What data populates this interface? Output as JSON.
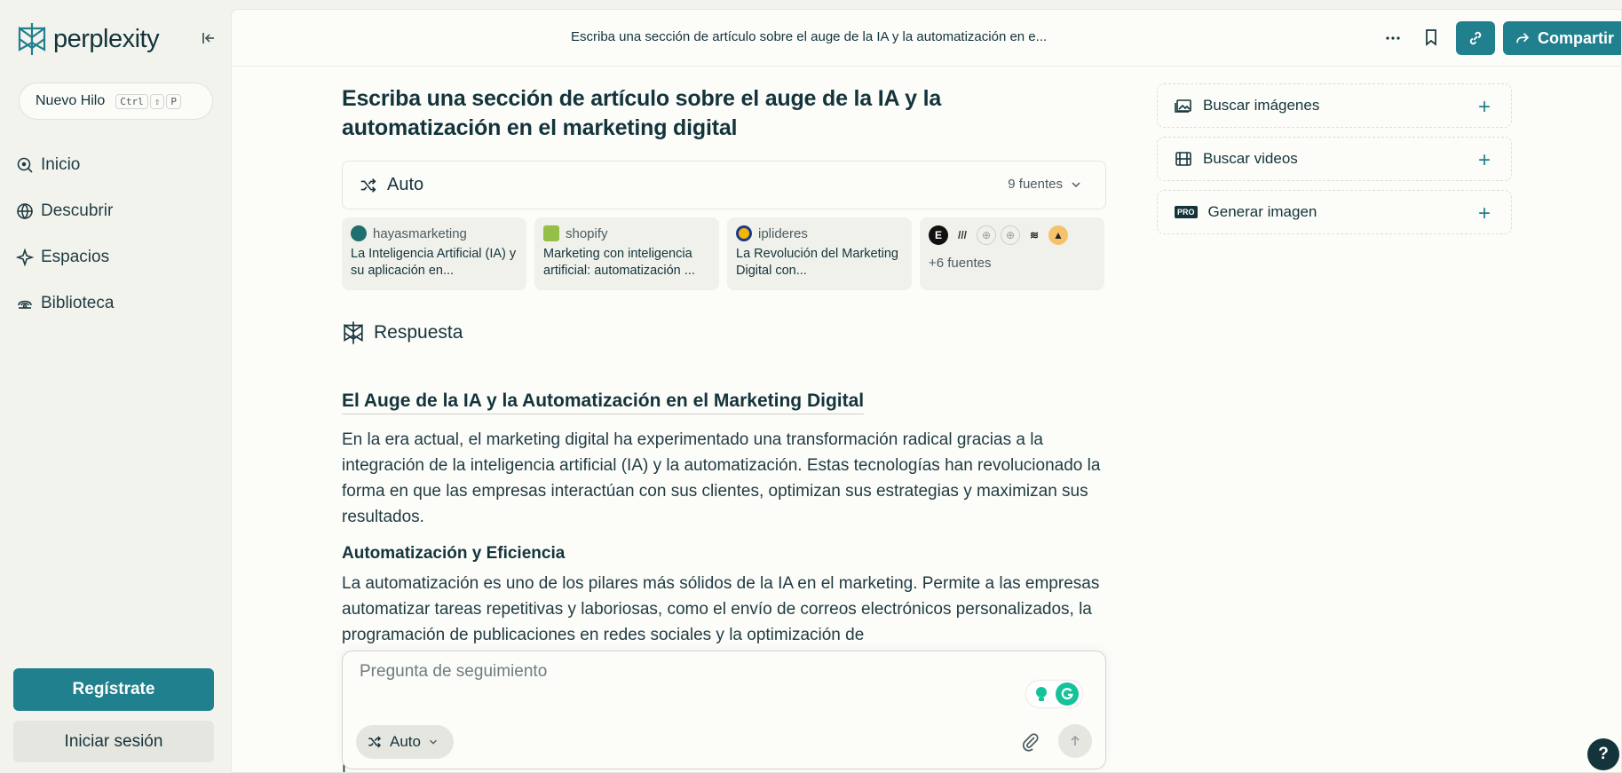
{
  "sidebar": {
    "logo_text": "perplexity",
    "new_thread": {
      "label": "Nuevo Hilo",
      "shortcut": [
        "Ctrl",
        "⇧",
        "P"
      ]
    },
    "nav": [
      {
        "label": "Inicio",
        "icon": "home-search-icon"
      },
      {
        "label": "Descubrir",
        "icon": "globe-icon"
      },
      {
        "label": "Espacios",
        "icon": "sparkle-icon"
      },
      {
        "label": "Biblioteca",
        "icon": "library-icon"
      }
    ],
    "signup_label": "Regístrate",
    "login_label": "Iniciar sesión"
  },
  "topbar": {
    "title": "Escriba una sección de artículo sobre el auge de la IA y la automatización en e...",
    "share_label": "Compartir"
  },
  "thread": {
    "question": "Escriba una sección de artículo sobre el auge de la IA y la automatización en el marketing digital",
    "mode_label": "Auto",
    "sources_count": "9 fuentes",
    "sources": [
      {
        "site": "hayasmarketing",
        "title": "La Inteligencia Artificial (IA) y su aplicación en...",
        "color": "#1f6f6f"
      },
      {
        "site": "shopify",
        "title": "Marketing con inteligencia artificial: automatización ...",
        "color": "#95bf47"
      },
      {
        "site": "iplideres",
        "title": "La Revolución del Marketing Digital con...",
        "color": "#f2b705"
      }
    ],
    "more_sources_label": "+6 fuentes",
    "answer_label": "Respuesta",
    "answer": {
      "heading": "El Auge de la IA y la Automatización en el Marketing Digital",
      "intro": "En la era actual, el marketing digital ha experimentado una transformación radical gracias a la integración de la inteligencia artificial (IA) y la automatización. Estas tecnologías han revolucionado la forma en que las empresas interactúan con sus clientes, optimizan sus estrategias y maximizan sus resultados.",
      "sub_heading": "Automatización y Eficiencia",
      "sub_text": "La automatización es uno de los pilares más sólidos de la IA en el marketing. Permite a las empresas automatizar tareas repetitivas y laboriosas, como el envío de correos electrónicos personalizados, la programación de publicaciones en redes sociales y la optimización de",
      "tail_text": "L"
    }
  },
  "followup": {
    "placeholder": "Pregunta de seguimiento",
    "mode_label": "Auto"
  },
  "right_panel": [
    {
      "label": "Buscar imágenes",
      "icon": "image-icon"
    },
    {
      "label": "Buscar videos",
      "icon": "video-icon"
    },
    {
      "label": "Generar imagen",
      "icon": "pro-badge-icon",
      "badge": "PRO"
    }
  ],
  "help_label": "?",
  "colors": {
    "accent": "#20808d",
    "text": "#13343b",
    "sidebar_bg": "#f3f3ee",
    "main_bg": "#fcfcf9"
  }
}
